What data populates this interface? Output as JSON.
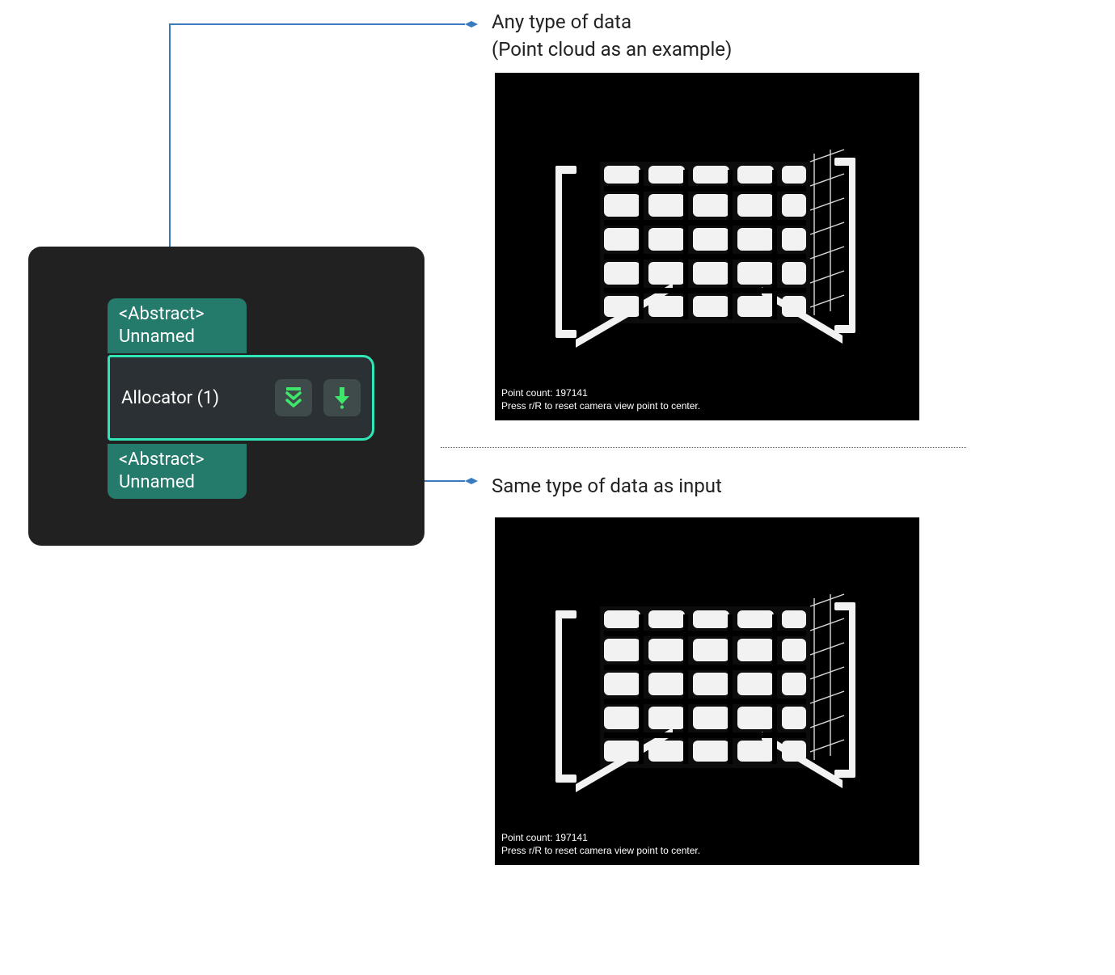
{
  "labels": {
    "top_line1": "Any type of data",
    "top_line2": "(Point cloud as an example)",
    "bottom": "Same type of data as input"
  },
  "node": {
    "input_port": {
      "type_label": "<Abstract>",
      "name": "Unnamed"
    },
    "title": "Allocator (1)",
    "output_port": {
      "type_label": "<Abstract>",
      "name": "Unnamed"
    }
  },
  "viewer": {
    "point_count_label": "Point count: 197141",
    "hint": "Press r/R to reset camera view point to center."
  },
  "colors": {
    "connector": "#3a7bbf",
    "accent": "#2ee6b6",
    "icon_green": "#3ee66a"
  }
}
